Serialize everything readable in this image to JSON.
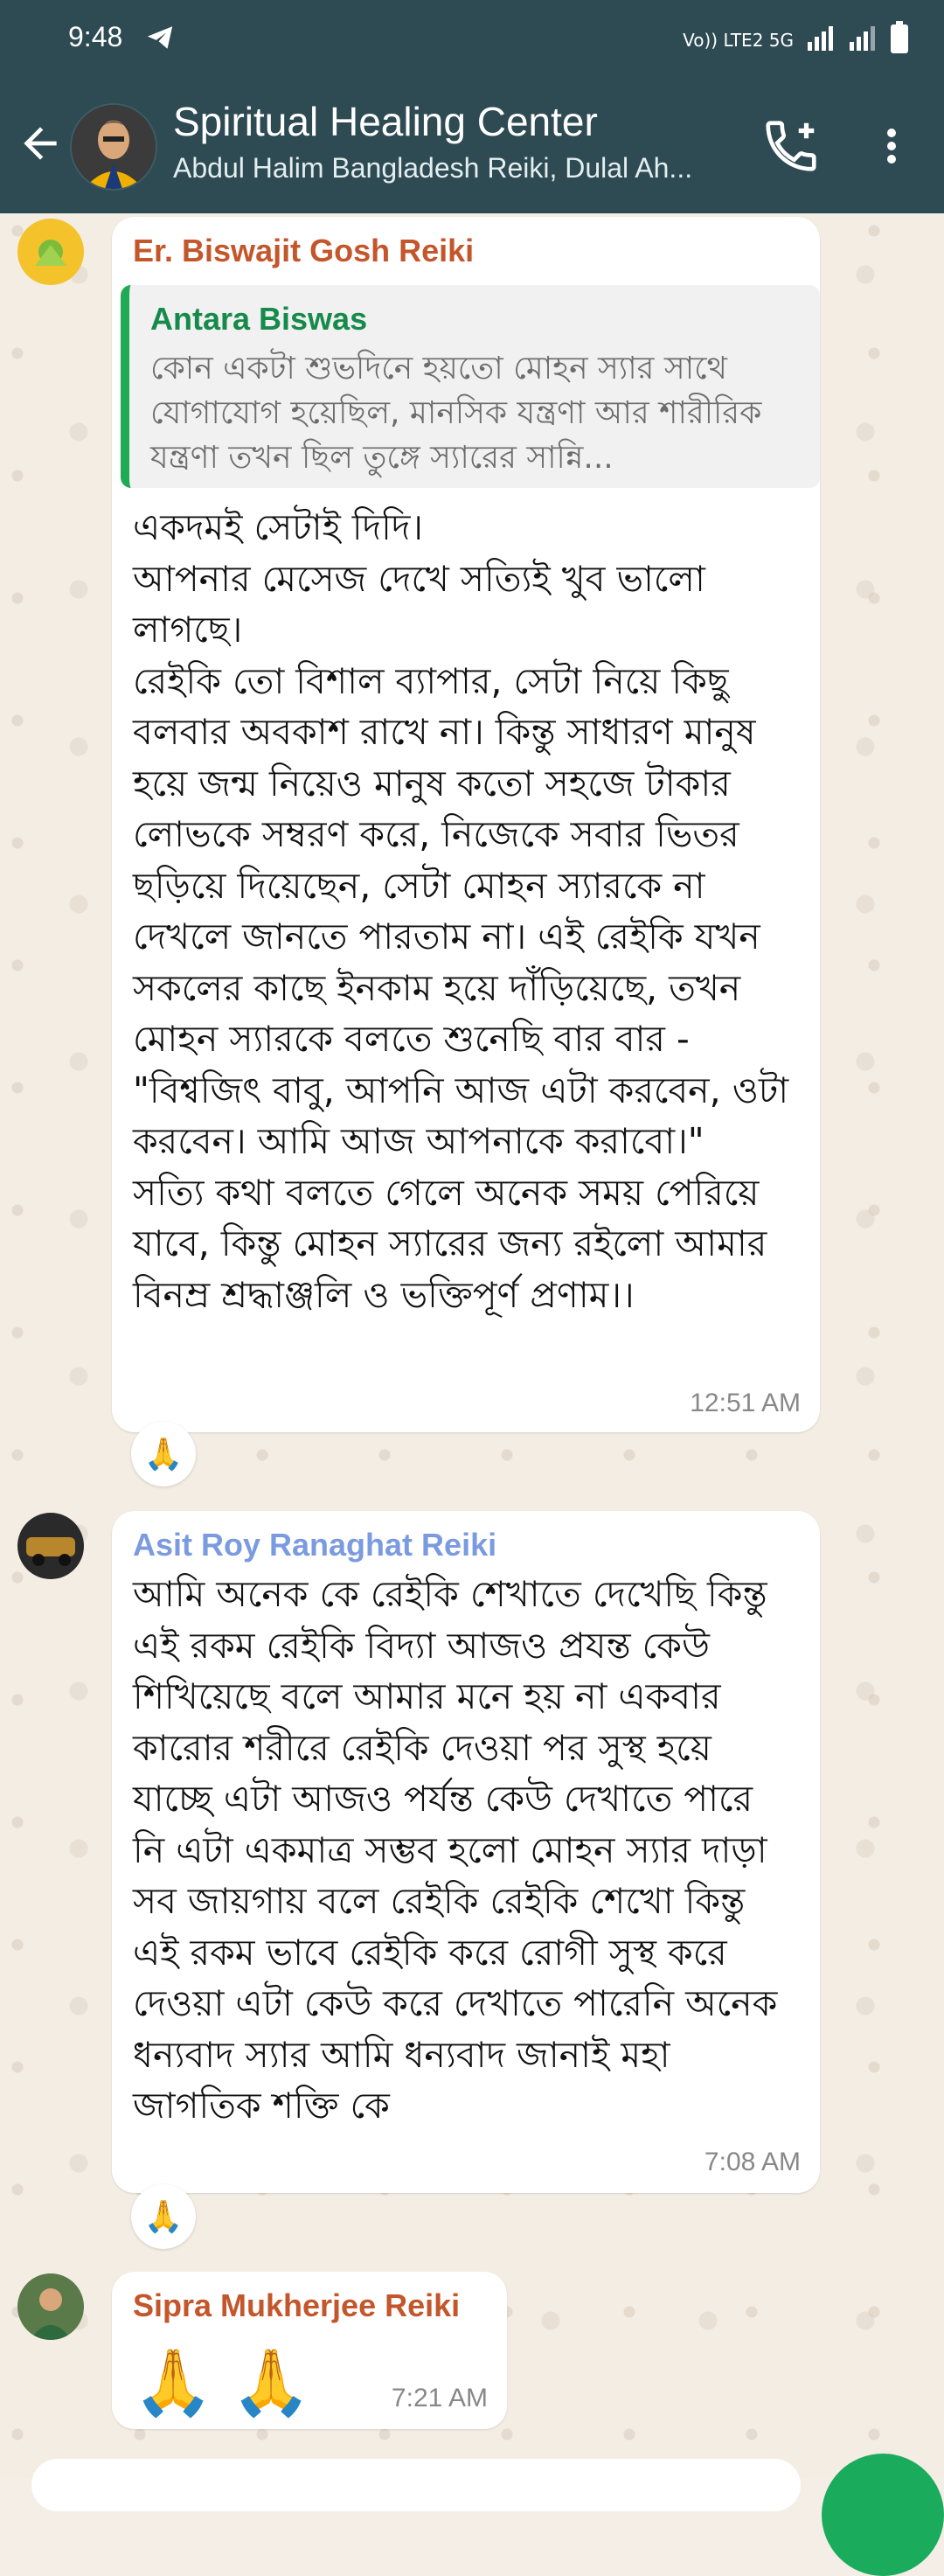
{
  "status_bar": {
    "time": "9:48",
    "indicators": "Vo)) LTE2 5G"
  },
  "header": {
    "title": "Spiritual Healing Center",
    "subtitle": "Abdul Halim Bangladesh Reiki, Dulal Ah..."
  },
  "messages": [
    {
      "sender": "Er. Biswajit Gosh Reiki",
      "sender_color": "#c4562b",
      "quote_name": "Antara Biswas",
      "quote_text": "কোন একটা শুভদিনে হয়তো মোহন স্যার সাথে যোগাযোগ হয়েছিল, মানসিক যন্ত্রণা আর শারীরিক যন্ত্রণা তখন ছিল তুঙ্গে স্যারের সান্নি...",
      "text": "একদমই সেটাই দিদি।\nআপনার মেসেজ দেখে সত্যিই খুব ভালো লাগছে।\nরেইকি তো বিশাল ব্যাপার, সেটা নিয়ে কিছু বলবার অবকাশ রাখে না। কিন্তু সাধারণ মানুষ হয়ে জন্ম নিয়েও মানুষ কতো সহজে টাকার লোভকে সম্বরণ করে, নিজেকে সবার ভিতর ছড়িয়ে দিয়েছেন, সেটা মোহন স্যারকে না দেখলে জানতে পারতাম না। এই রেইকি যখন সকলের কাছে ইনকাম হয়ে দাঁড়িয়েছে, তখন মোহন স্যারকে বলতে শুনেছি বার বার - \"বিশ্বজিৎ বাবু, আপনি আজ এটা করবেন, ওটা করবেন। আমি আজ আপনাকে করাবো।\"\nসত্যি কথা বলতে গেলে অনেক সময় পেরিয়ে যাবে, কিন্তু মোহন স্যারের জন্য রইলো আমার বিনম্র শ্রদ্ধাঞ্জলি ও ভক্তিপূর্ণ প্রণাম।।",
      "time": "12:51 AM",
      "reaction": "🙏"
    },
    {
      "sender": "Asit Roy Ranaghat Reiki",
      "sender_color": "#7b9be0",
      "text": "আমি অনেক কে রেইকি শেখাতে দেখেছি কিন্তু এই রকম রেইকি বিদ্যা আজও প্রযন্ত কেউ শিখিয়েছে বলে আমার মনে হয় না একবার কারোর শরীরে রেইকি দেওয়া পর সুস্থ হয়ে যাচ্ছে এটা আজও পর্যন্ত কেউ দেখাতে পারে নি এটা একমাত্র সম্ভব হলো মোহন স্যার দাড়া সব জায়গায় বলে রেইকি রেইকি শেখো কিন্তু এই রকম ভাবে রেইকি করে রোগী সুস্থ করে দেওয়া এটা কেউ করে দেখাতে পারেনি অনেক ধন্যবাদ স্যার আমি ধন্যবাদ জানাই মহা জাগতিক শক্তি কে",
      "time": "7:08 AM",
      "reaction": "🙏"
    },
    {
      "sender": "Sipra Mukherjee  Reiki",
      "sender_color": "#c4562b",
      "text": "🙏🙏",
      "time": "7:21 AM"
    }
  ]
}
